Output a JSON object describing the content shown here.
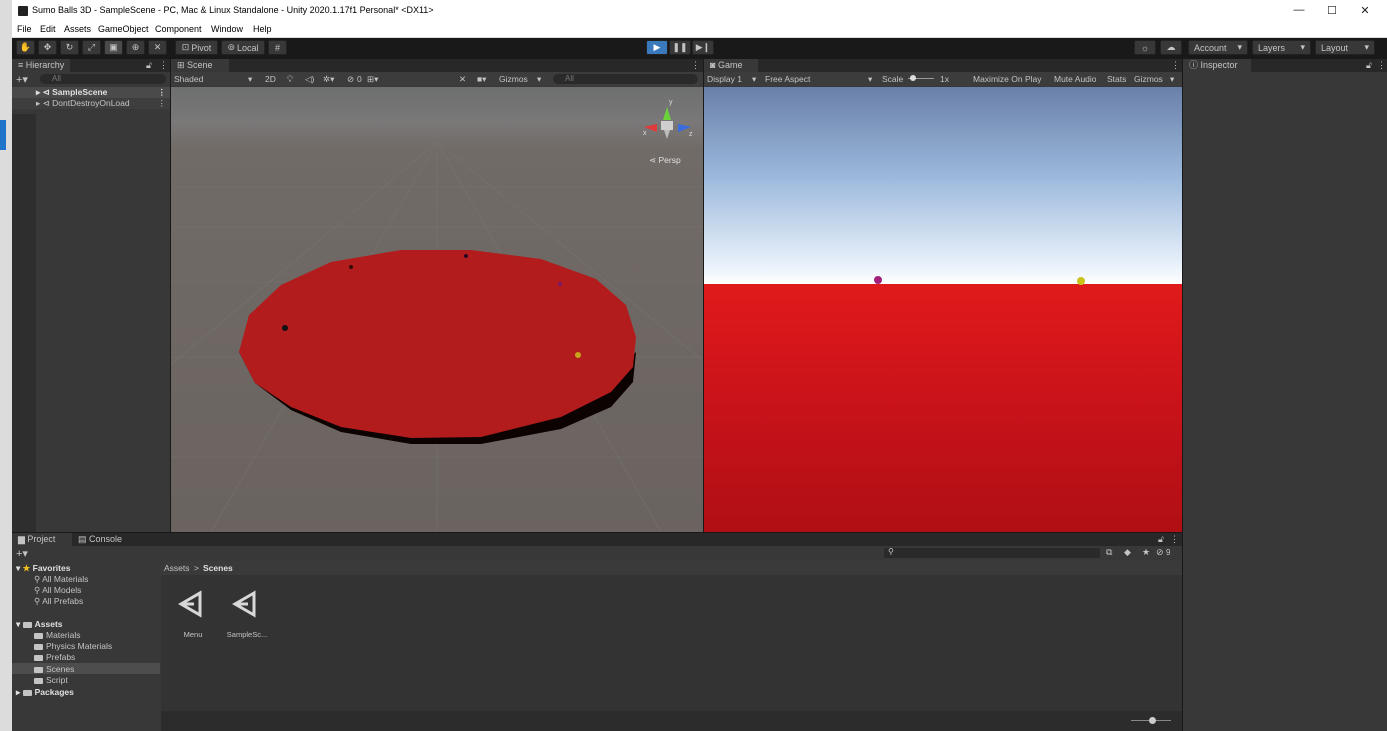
{
  "window": {
    "title": "Sumo Balls 3D - SampleScene - PC, Mac & Linux Standalone - Unity 2020.1.17f1 Personal* <DX11>",
    "controls": {
      "minimize": "—",
      "maximize": "☐",
      "close": "✕"
    }
  },
  "menu": [
    "File",
    "Edit",
    "Assets",
    "GameObject",
    "Component",
    "Window",
    "Help"
  ],
  "toolbar": {
    "pivot": "Pivot",
    "local": "Local",
    "account": "Account",
    "layers": "Layers",
    "layout": "Layout",
    "play_icon": "play-icon",
    "pause_icon": "pause-icon",
    "step_icon": "step-icon",
    "accent": "#3a79bb"
  },
  "hierarchy": {
    "tab": "Hierarchy",
    "search_placeholder": "All",
    "items": [
      "SampleScene",
      "DontDestroyOnLoad"
    ]
  },
  "scene": {
    "tab": "Scene",
    "shading": "Shaded",
    "mode_2d": "2D",
    "hidden_count": "0",
    "gizmos": "Gizmos",
    "search_placeholder": "All",
    "persp": "Persp",
    "gizmo_axes": {
      "y": "y",
      "x": "x",
      "z": "z"
    },
    "platform_color": "#b01c1c"
  },
  "game": {
    "tab": "Game",
    "display": "Display 1",
    "aspect": "Free Aspect",
    "scale_label": "Scale",
    "scale_value": "1x",
    "maximize_on_play": "Maximize On Play",
    "mute_audio": "Mute Audio",
    "stats": "Stats",
    "gizmos": "Gizmos"
  },
  "inspector": {
    "tab": "Inspector"
  },
  "project": {
    "tab_project": "Project",
    "tab_console": "Console",
    "search_placeholder": "",
    "hidden_count": "9",
    "favorites_label": "Favorites",
    "favorites": [
      "All Materials",
      "All Models",
      "All Prefabs"
    ],
    "assets_label": "Assets",
    "asset_folders": [
      "Materials",
      "Physics Materials",
      "Prefabs",
      "Scenes",
      "Script"
    ],
    "packages_label": "Packages",
    "breadcrumb_root": "Assets",
    "breadcrumb_sep": ">",
    "breadcrumb_current": "Scenes",
    "files": [
      "Menu",
      "SampleSc..."
    ]
  }
}
